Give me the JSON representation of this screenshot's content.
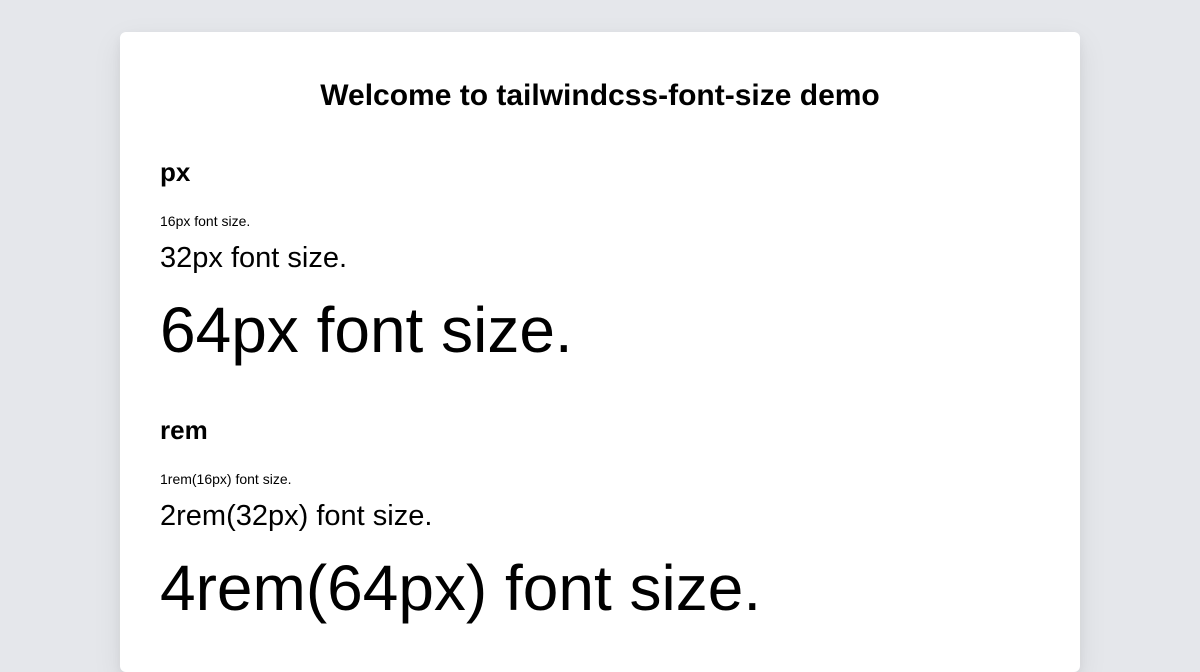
{
  "page": {
    "title": "Welcome to tailwindcss-font-size demo"
  },
  "sections": [
    {
      "heading": "px",
      "samples": [
        "16px font size.",
        "32px font size.",
        "64px font size."
      ]
    },
    {
      "heading": "rem",
      "samples": [
        "1rem(16px) font size.",
        "2rem(32px) font size.",
        "4rem(64px) font size."
      ]
    }
  ],
  "colors": {
    "background": "#e5e7eb",
    "card": "#ffffff",
    "text": "#000000"
  }
}
